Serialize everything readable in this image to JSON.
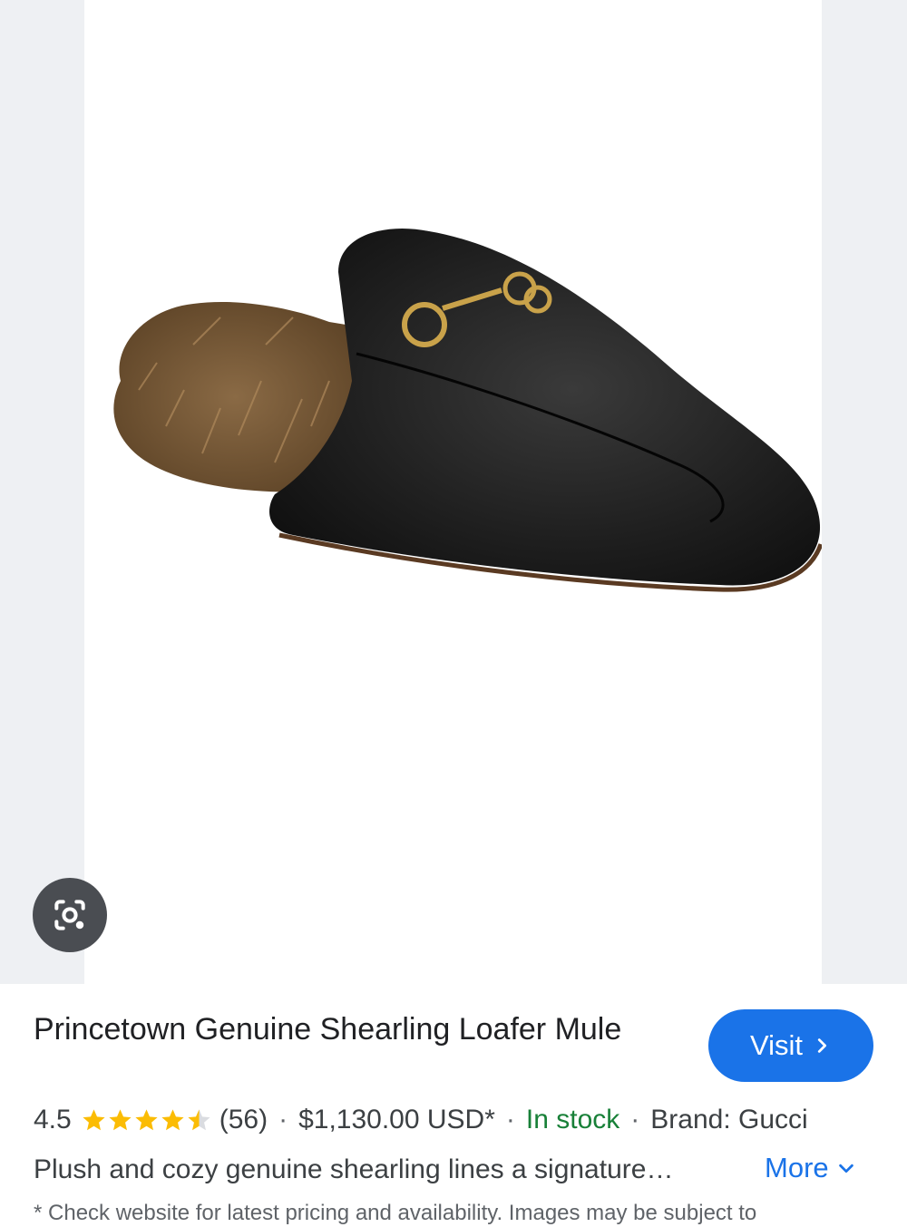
{
  "product": {
    "title": "Princetown Genuine Shearling Loafer Mule",
    "rating": "4.5",
    "rating_value": 4.5,
    "review_count": "(56)",
    "price": "$1,130.00 USD*",
    "availability": "In stock",
    "brand": "Brand: Gucci",
    "description": "Plush and cozy genuine shearling lines a signature…",
    "footnote": "* Check website for latest pricing and availability. Images may be subject to"
  },
  "actions": {
    "visit_label": "Visit",
    "more_label": "More"
  },
  "separator": "·",
  "icons": {
    "lens": "google-lens-icon",
    "visit": "chevron-right-icon",
    "more": "chevron-down-icon",
    "star": "star-icon"
  },
  "colors": {
    "accent": "#1a73e8",
    "in_stock": "#188038",
    "star": "#fbbc04"
  }
}
